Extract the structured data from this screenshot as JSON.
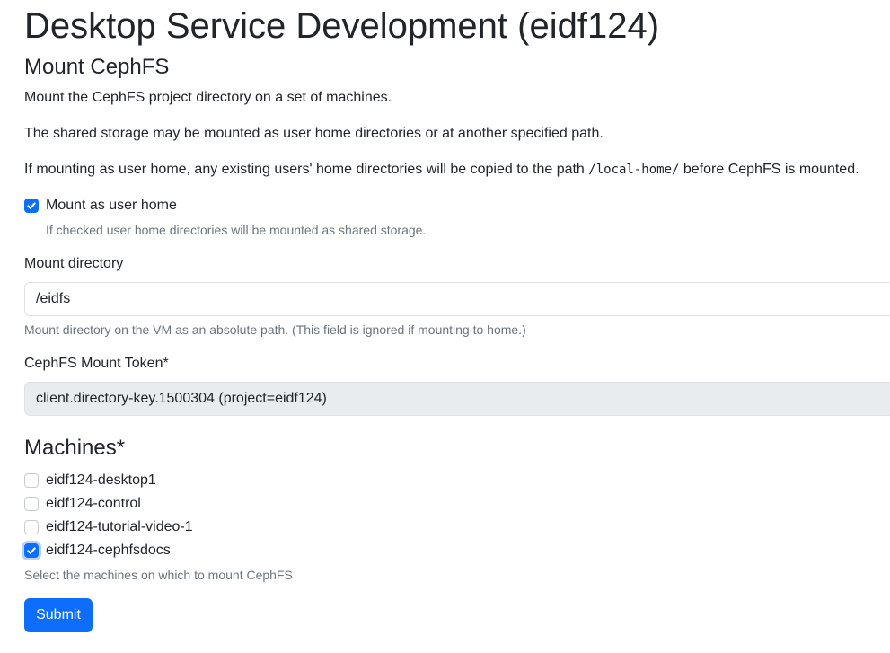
{
  "header": {
    "title": "Desktop Service Development (eidf124)"
  },
  "form": {
    "title": "Mount CephFS",
    "intro_1": "Mount the CephFS project directory on a set of machines.",
    "intro_2": "The shared storage may be mounted as user home directories or at another specified path.",
    "intro_3_prefix": "If mounting as user home, any existing users' home directories will be copied to the path ",
    "intro_3_code": "/local-home/",
    "intro_3_suffix": " before CephFS is mounted.",
    "mount_home": {
      "label": "Mount as user home",
      "checked": true,
      "help": "If checked user home directories will be mounted as shared storage."
    },
    "mount_directory": {
      "label": "Mount directory",
      "value": "/eidfs",
      "help": "Mount directory on the VM as an absolute path. (This field is ignored if mounting to home.)"
    },
    "mount_token": {
      "label": "CephFS Mount Token*",
      "value": "client.directory-key.1500304 (project=eidf124)"
    },
    "machines": {
      "title": "Machines*",
      "items": [
        {
          "label": "eidf124-desktop1",
          "checked": false
        },
        {
          "label": "eidf124-control",
          "checked": false
        },
        {
          "label": "eidf124-tutorial-video-1",
          "checked": false
        },
        {
          "label": "eidf124-cephfsdocs",
          "checked": true
        }
      ],
      "help": "Select the machines on which to mount CephFS"
    },
    "submit_label": "Submit"
  },
  "colors": {
    "primary": "#0d6efd",
    "muted_text": "#6c757d",
    "readonly_bg": "#e9ecef",
    "border": "#dee2e6"
  }
}
